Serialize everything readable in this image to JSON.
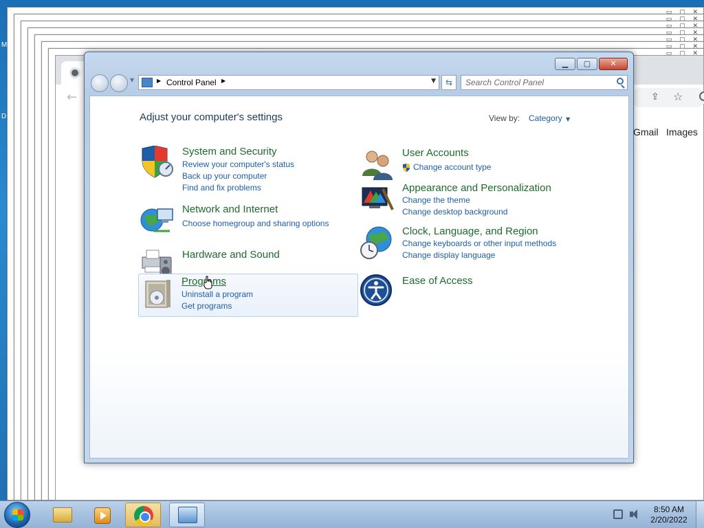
{
  "desktop": {
    "edge_labels": [
      "M",
      "D"
    ]
  },
  "chrome": {
    "links": [
      "Gmail",
      "Images"
    ]
  },
  "control_panel": {
    "address": {
      "current": "Control Panel"
    },
    "search": {
      "placeholder": "Search Control Panel"
    },
    "heading": "Adjust your computer's settings",
    "view_by_label": "View by:",
    "view_by_value": "Category",
    "categories": [
      {
        "title": "System and Security",
        "links": [
          "Review your computer's status",
          "Back up your computer",
          "Find and fix problems"
        ],
        "icon": "shield-icon"
      },
      {
        "title": "Network and Internet",
        "links": [
          "Choose homegroup and sharing options"
        ],
        "icon": "network-globe-icon"
      },
      {
        "title": "Hardware and Sound",
        "links": [],
        "icon": "printer-speaker-icon"
      },
      {
        "title": "Programs",
        "links": [
          "Uninstall a program",
          "Get programs"
        ],
        "icon": "programs-box-icon"
      },
      {
        "title": "User Accounts",
        "links": [
          "Change account type"
        ],
        "icon": "users-icon"
      },
      {
        "title": "Appearance and Personalization",
        "links": [
          "Change the theme",
          "Change desktop background"
        ],
        "icon": "monitor-paint-icon"
      },
      {
        "title": "Clock, Language, and Region",
        "links": [
          "Change keyboards or other input methods",
          "Change display language"
        ],
        "icon": "clock-globe-icon"
      },
      {
        "title": "Ease of Access",
        "links": [],
        "icon": "ease-of-access-icon"
      }
    ]
  },
  "taskbar": {
    "time": "8:50 AM",
    "date": "2/20/2022",
    "buttons": [
      "windows-explorer",
      "media-player",
      "google-chrome",
      "control-panel"
    ]
  },
  "colors": {
    "category_title": "#1d6a2b",
    "link": "#1e5ea8",
    "heading": "#1e395b"
  }
}
